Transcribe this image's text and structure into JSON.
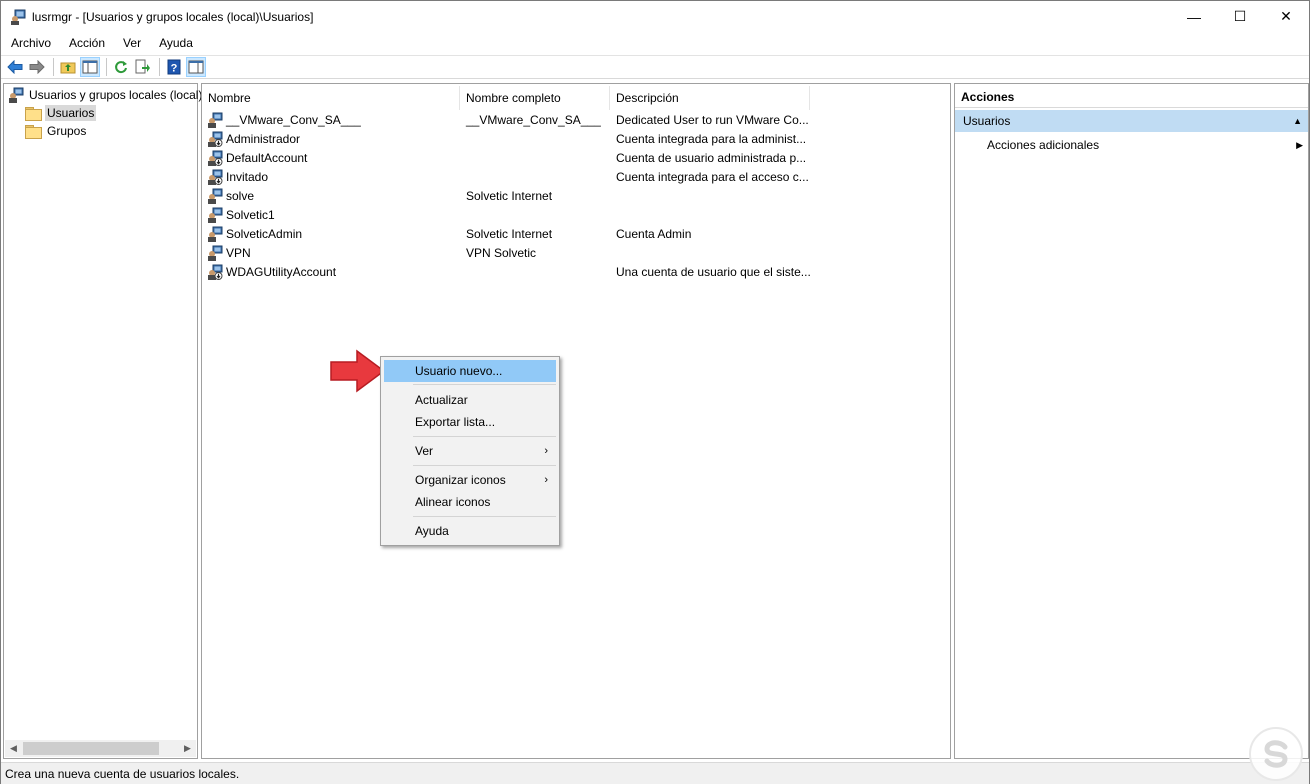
{
  "window": {
    "title": "lusrmgr - [Usuarios y grupos locales (local)\\Usuarios]",
    "minimize": "—",
    "maximize": "☐",
    "close": "✕"
  },
  "menu": [
    "Archivo",
    "Acción",
    "Ver",
    "Ayuda"
  ],
  "toolbar": {
    "icons": [
      "back-arrow-icon",
      "forward-arrow-icon",
      "up-folder-icon",
      "show-hide-tree-icon",
      "refresh-icon",
      "export-list-icon",
      "help-icon",
      "show-hide-action-pane-icon"
    ]
  },
  "tree": {
    "root": "Usuarios y grupos locales (local)",
    "items": [
      "Usuarios",
      "Grupos"
    ],
    "selected": "Usuarios"
  },
  "list": {
    "columns": [
      "Nombre",
      "Nombre completo",
      "Descripción"
    ],
    "rows": [
      {
        "name": "__VMware_Conv_SA___",
        "full": "__VMware_Conv_SA___",
        "desc": "Dedicated User to run VMware Co...",
        "disabled": false
      },
      {
        "name": "Administrador",
        "full": "",
        "desc": "Cuenta integrada para la administ...",
        "disabled": true
      },
      {
        "name": "DefaultAccount",
        "full": "",
        "desc": "Cuenta de usuario administrada p...",
        "disabled": true
      },
      {
        "name": "Invitado",
        "full": "",
        "desc": "Cuenta integrada para el acceso c...",
        "disabled": true
      },
      {
        "name": "solve",
        "full": "Solvetic Internet",
        "desc": "",
        "disabled": false
      },
      {
        "name": "Solvetic1",
        "full": "",
        "desc": "",
        "disabled": false
      },
      {
        "name": "SolveticAdmin",
        "full": "Solvetic Internet",
        "desc": "Cuenta Admin",
        "disabled": false
      },
      {
        "name": "VPN",
        "full": "VPN Solvetic",
        "desc": "",
        "disabled": false
      },
      {
        "name": "WDAGUtilityAccount",
        "full": "",
        "desc": "Una cuenta de usuario que el siste...",
        "disabled": true
      }
    ]
  },
  "actions": {
    "title": "Acciones",
    "section": "Usuarios",
    "items": [
      "Acciones adicionales"
    ]
  },
  "context_menu": {
    "items": [
      "Usuario nuevo...",
      "Actualizar",
      "Exportar lista...",
      "Ver",
      "Organizar iconos",
      "Alinear iconos",
      "Ayuda"
    ],
    "highlighted": "Usuario nuevo..."
  },
  "status": "Crea una nueva cuenta de usuarios locales.",
  "colors": {
    "selection": "#91c9f7",
    "actions_header": "#c0dcf3",
    "arrow": "#e8393e"
  }
}
